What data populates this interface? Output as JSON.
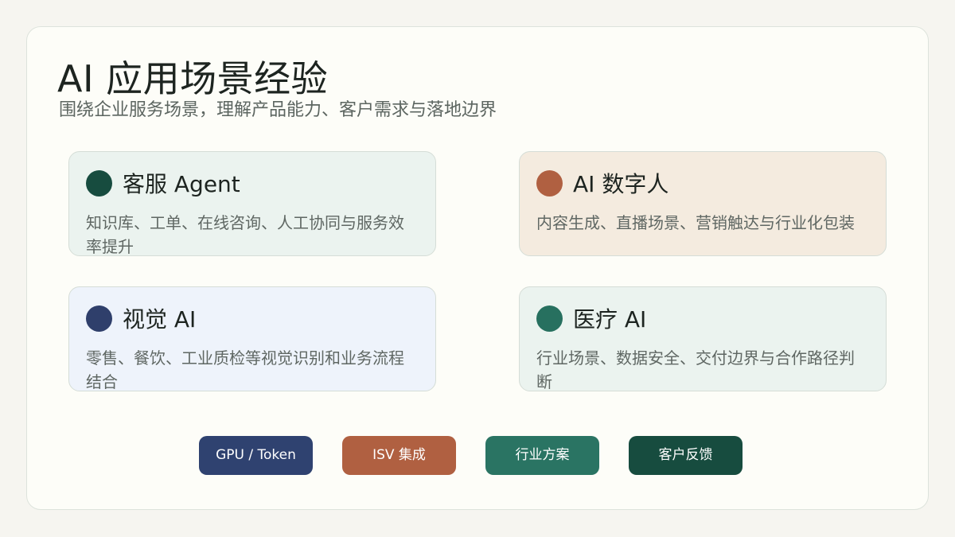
{
  "header": {
    "title": "AI 应用场景经验",
    "subtitle": "围绕企业服务场景，理解产品能力、客户需求与落地边界"
  },
  "tiles": [
    {
      "title": "客服 Agent",
      "description": "知识库、工单、在线咨询、人工协同与服务效率提升",
      "bg": "#ebf3ef",
      "dot": "#174c3f"
    },
    {
      "title": "AI 数字人",
      "description": "内容生成、直播场景、营销触达与行业化包装",
      "bg": "#f4ebdf",
      "dot": "#b06041"
    },
    {
      "title": "视觉 AI",
      "description": "零售、餐饮、工业质检等视觉识别和业务流程结合",
      "bg": "#eef3fb",
      "dot": "#2f3f6b"
    },
    {
      "title": "医疗 AI",
      "description": "行业场景、数据安全、交付边界与合作路径判断",
      "bg": "#ebf3ef",
      "dot": "#27705f"
    }
  ],
  "tags": [
    {
      "label": "GPU / Token",
      "color": "#2f4270"
    },
    {
      "label": "ISV 集成",
      "color": "#b06041"
    },
    {
      "label": "行业方案",
      "color": "#2a7463"
    },
    {
      "label": "客户反馈",
      "color": "#174c3f"
    }
  ]
}
